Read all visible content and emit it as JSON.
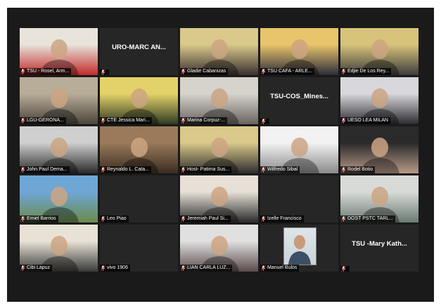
{
  "meeting": {
    "participants": [
      {
        "label": "TSU - Rosel, Arm...",
        "heading": "",
        "video": true,
        "colors": [
          "#e8e4dc",
          "#c22a2a"
        ]
      },
      {
        "label": "",
        "heading": "URO-MARC AN...",
        "video": false,
        "colors": [
          "#262626",
          "#262626"
        ]
      },
      {
        "label": "Gladie Cabanizas",
        "heading": "",
        "video": true,
        "active": true,
        "colors": [
          "#d9c98a",
          "#3a3030"
        ]
      },
      {
        "label": "TSU CAFA - ARLE...",
        "heading": "",
        "video": true,
        "colors": [
          "#e8c46a",
          "#2c2c3a"
        ]
      },
      {
        "label": "Edjie De Los Rey...",
        "heading": "",
        "video": true,
        "colors": [
          "#d7c37a",
          "#3c3c3c"
        ]
      },
      {
        "label": "LGU-GERONA...",
        "heading": "",
        "video": true,
        "colors": [
          "#b8ad98",
          "#4a443a"
        ]
      },
      {
        "label": "CTE Jessica Mari...",
        "heading": "",
        "video": true,
        "colors": [
          "#e3d26a",
          "#2f3a22"
        ]
      },
      {
        "label": "Marina Corpuz-...",
        "heading": "",
        "video": true,
        "colors": [
          "#d6d2cc",
          "#6a6460"
        ]
      },
      {
        "label": "",
        "heading": "TSU-COS_Mines...",
        "video": false,
        "colors": [
          "#262626",
          "#262626"
        ]
      },
      {
        "label": "UESO LEA MILAN",
        "heading": "",
        "video": true,
        "colors": [
          "#d8d8dc",
          "#2a2a30"
        ]
      },
      {
        "label": "John Paul Dema...",
        "heading": "",
        "video": true,
        "colors": [
          "#cfcfcf",
          "#2a2a2a"
        ]
      },
      {
        "label": "Reynaldo L. Cata...",
        "heading": "",
        "video": true,
        "colors": [
          "#9a7a5a",
          "#3a2c20"
        ]
      },
      {
        "label": "Host- Patima Sus...",
        "heading": "",
        "video": true,
        "colors": [
          "#d9c98a",
          "#2c2c2c"
        ]
      },
      {
        "label": "Wilfredo Sibal",
        "heading": "",
        "video": true,
        "colors": [
          "#f2f2f2",
          "#8a8a8a"
        ]
      },
      {
        "label": "Rodel Botio",
        "heading": "",
        "video": true,
        "colors": [
          "#2a2a2a",
          "#b89a88"
        ]
      },
      {
        "label": "Emiel Barrios",
        "heading": "",
        "video": true,
        "colors": [
          "#6ea6d6",
          "#6a8a4a"
        ]
      },
      {
        "label": "Leo Piao",
        "heading": "",
        "video": false,
        "colors": [
          "#262626",
          "#262626"
        ]
      },
      {
        "label": "Jeremiah Paul Si...",
        "heading": "",
        "video": true,
        "colors": [
          "#e6e0d6",
          "#2a2a2a"
        ]
      },
      {
        "label": "Izelle Francisco",
        "heading": "",
        "video": false,
        "colors": [
          "#262626",
          "#262626"
        ]
      },
      {
        "label": "DOST PSTC TARL...",
        "heading": "",
        "video": true,
        "colors": [
          "#d8dad8",
          "#6a7a70"
        ]
      },
      {
        "label": "Cibi Lapuz",
        "heading": "",
        "video": true,
        "colors": [
          "#e8e2d6",
          "#3a3a3a"
        ]
      },
      {
        "label": "vivo 1906",
        "heading": "",
        "video": false,
        "colors": [
          "#262626",
          "#262626"
        ]
      },
      {
        "label": "LIAN CARLA LUZ...",
        "heading": "",
        "video": true,
        "colors": [
          "#e0e0e0",
          "#5a4a4a"
        ]
      },
      {
        "label": "Manuel Bulos",
        "heading": "",
        "video": false,
        "photo": true,
        "colors": [
          "#262626",
          "#262626"
        ]
      },
      {
        "label": "",
        "heading": "TSU -Mary Kath...",
        "video": false,
        "colors": [
          "#262626",
          "#262626"
        ]
      }
    ],
    "colors": {
      "muted_icon": "#e02424",
      "active_border": "#c8d12b",
      "background": "#1a1a1a",
      "tile": "#262626"
    }
  }
}
